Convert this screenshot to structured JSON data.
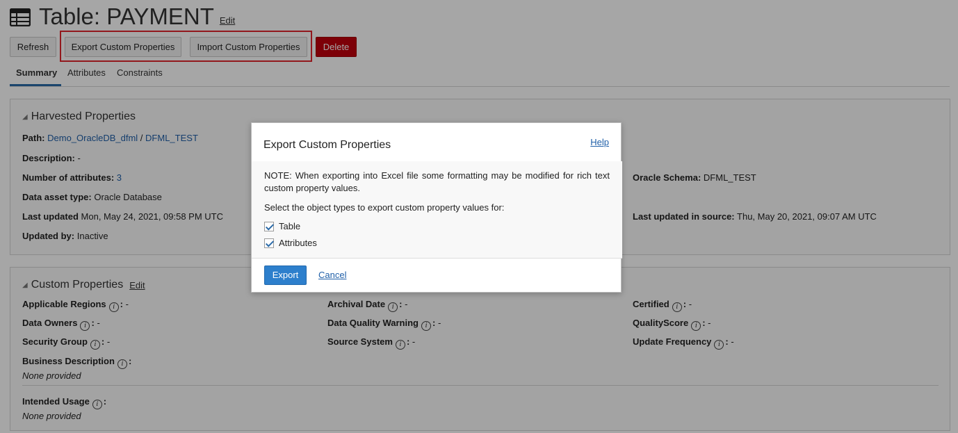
{
  "header": {
    "title": "Table: PAYMENT",
    "edit_label": "Edit"
  },
  "toolbar": {
    "refresh": "Refresh",
    "export": "Export Custom Properties",
    "import": "Import Custom Properties",
    "delete": "Delete"
  },
  "tabs": [
    {
      "label": "Summary",
      "active": true
    },
    {
      "label": "Attributes",
      "active": false
    },
    {
      "label": "Constraints",
      "active": false
    }
  ],
  "harvested": {
    "title": "Harvested Properties",
    "path_label": "Path:",
    "path_part1": "Demo_OracleDB_dfml",
    "path_sep": "/",
    "path_part2": "DFML_TEST",
    "description_label": "Description:",
    "description_value": "-",
    "num_attr_label": "Number of attributes:",
    "num_attr_value": "3",
    "asset_type_label": "Data asset type:",
    "asset_type_value": "Oracle Database",
    "last_updated_label": "Last updated",
    "last_updated_value": "Mon, May 24, 2021, 09:58 PM UTC",
    "updated_by_label": "Updated by:",
    "updated_by_value": "Inactive",
    "schema_label": "Oracle Schema:",
    "schema_value": "DFML_TEST",
    "last_updated_src_label": "Last updated in source:",
    "last_updated_src_value": "Thu, May 20, 2021, 09:07 AM UTC"
  },
  "custom": {
    "title": "Custom Properties",
    "edit_label": "Edit",
    "fields": {
      "applicable_regions": {
        "label": "Applicable Regions",
        "value": "-"
      },
      "data_owners": {
        "label": "Data Owners",
        "value": "-"
      },
      "security_group": {
        "label": "Security Group",
        "value": "-"
      },
      "archival_date": {
        "label": "Archival Date",
        "value": "-"
      },
      "data_quality_warning": {
        "label": "Data Quality Warning",
        "value": "-"
      },
      "source_system": {
        "label": "Source System",
        "value": "-"
      },
      "certified": {
        "label": "Certified",
        "value": "-"
      },
      "quality_score": {
        "label": "QualityScore",
        "value": "-"
      },
      "update_frequency": {
        "label": "Update Frequency",
        "value": "-"
      }
    },
    "business_description": {
      "label": "Business Description",
      "value": "None provided"
    },
    "intended_usage": {
      "label": "Intended Usage",
      "value": "None provided"
    }
  },
  "info_glyph": "i",
  "colon": ":",
  "dialog": {
    "title": "Export Custom Properties",
    "help": "Help",
    "note": "NOTE: When exporting into Excel file some formatting may be modified for rich text custom property values.",
    "select_label": "Select the object types to export custom property values for:",
    "options": [
      {
        "label": "Table",
        "checked": true
      },
      {
        "label": "Attributes",
        "checked": true
      }
    ],
    "export_button": "Export",
    "cancel_link": "Cancel"
  },
  "colors": {
    "primary_blue": "#2d7fcc",
    "delete_red": "#c0000d",
    "highlight_red": "#e0262d",
    "link_blue": "#1f5fa8"
  },
  "icons": {
    "title_icon": "table-grid-icon",
    "info_icon": "info-circle-icon",
    "section_toggle": "triangle-collapse-icon",
    "checkbox": "checkmark-icon"
  }
}
